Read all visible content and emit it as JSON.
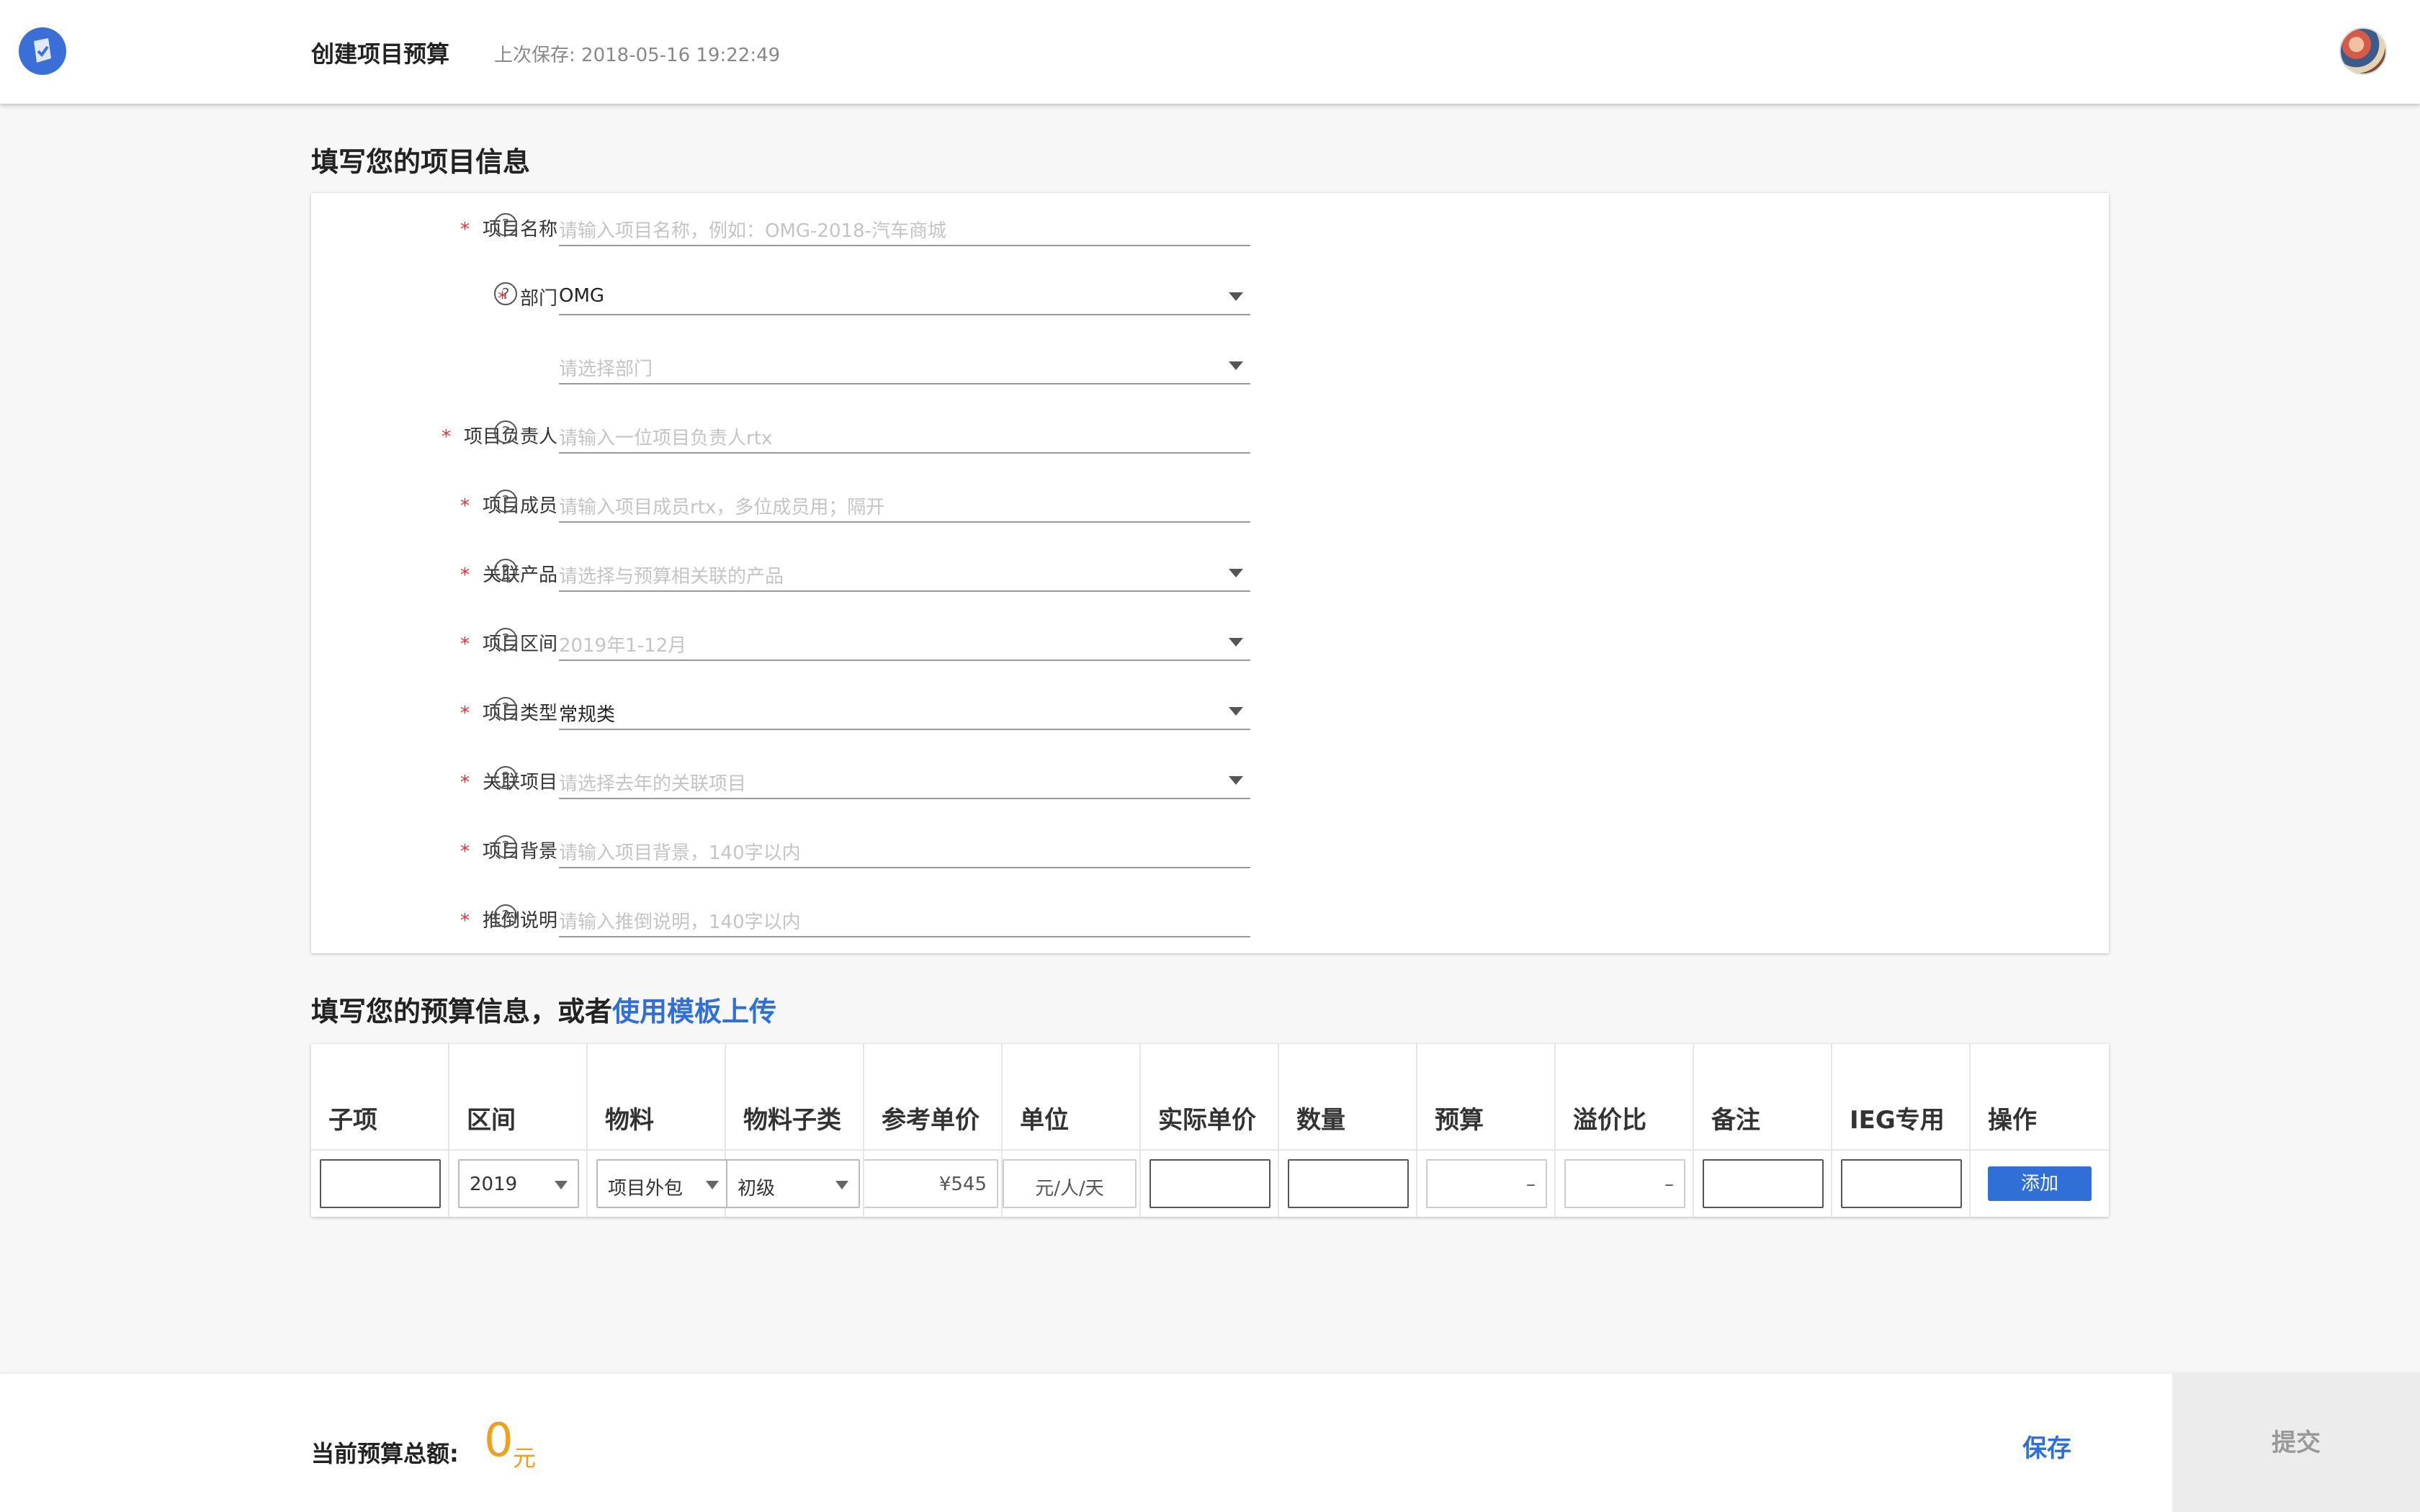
{
  "header": {
    "title": "创建项目预算",
    "saved_text": "上次保存: 2018-05-16 19:22:49"
  },
  "project_section": {
    "title": "填写您的项目信息",
    "fields": [
      {
        "label": "项目名称",
        "required": true,
        "value": "",
        "placeholder": "请输入项目名称，例如：OMG-2018-汽车商城",
        "dropdown": false
      },
      {
        "label": "部门",
        "required": true,
        "value": "OMG",
        "placeholder": "",
        "dropdown": true
      },
      {
        "label": "",
        "required": false,
        "value": "",
        "placeholder": "请选择部门",
        "dropdown": true
      },
      {
        "label": "项目负责人",
        "required": true,
        "value": "",
        "placeholder": "请输入一位项目负责人rtx",
        "dropdown": false
      },
      {
        "label": "项目成员",
        "required": true,
        "value": "",
        "placeholder": "请输入项目成员rtx，多位成员用；隔开",
        "dropdown": false
      },
      {
        "label": "关联产品",
        "required": true,
        "value": "",
        "placeholder": "请选择与预算相关联的产品",
        "dropdown": true
      },
      {
        "label": "项目区间",
        "required": true,
        "value": "",
        "placeholder": "2019年1-12月",
        "dropdown": true
      },
      {
        "label": "项目类型",
        "required": true,
        "value": "常规类",
        "placeholder": "",
        "dropdown": true
      },
      {
        "label": "关联项目",
        "required": true,
        "value": "",
        "placeholder": "请选择去年的关联项目",
        "dropdown": true
      },
      {
        "label": "项目背景",
        "required": true,
        "value": "",
        "placeholder": "请输入项目背景，140字以内",
        "dropdown": false
      },
      {
        "label": "推倒说明",
        "required": true,
        "value": "",
        "placeholder": "请输入推倒说明，140字以内",
        "dropdown": false
      }
    ]
  },
  "budget_section": {
    "title_prefix": "填写您的预算信息，或者",
    "title_link": "使用模板上传",
    "columns": [
      "子项",
      "区间",
      "物料",
      "物料子类",
      "参考单价",
      "单位",
      "实际单价",
      "数量",
      "预算",
      "溢价比",
      "备注",
      "IEG专用",
      "操作"
    ],
    "row": {
      "subitem": "",
      "period": "2019",
      "material": "项目外包",
      "material_sub": "初级",
      "ref_price": "¥545",
      "unit": "元/人/天",
      "actual_price": "",
      "quantity": "",
      "budget": "–",
      "premium": "–",
      "note": "",
      "ieg": "",
      "action": "添加"
    }
  },
  "footer": {
    "total_label": "当前预算总额:",
    "total_value": "0",
    "total_unit": "元",
    "save": "保存",
    "submit": "提交"
  },
  "colors": {
    "primary": "#2f6fd6",
    "required": "#e0323c",
    "amount": "#f0a020"
  }
}
